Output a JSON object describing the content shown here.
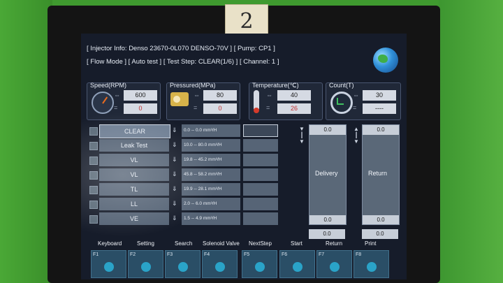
{
  "header": {
    "line1": "[ Injector Info: Denso   23670-0L070  DENSO-70V ]    [ Pump: CP1 ]",
    "line2": "[ Flow Mode ]    [ Auto test ]    [ Test Step: CLEAR(1/6) ]    [ Channel: 1 ]"
  },
  "sticker": {
    "text": "2"
  },
  "panels": {
    "speed": {
      "title": "Speed(RPM)",
      "set": "600",
      "actual": "0"
    },
    "pressure": {
      "title": "Pressured(MPa)",
      "set": "80",
      "actual": "0"
    },
    "temperature": {
      "title": "Temperature(℃)",
      "set": "40",
      "actual": "26"
    },
    "count": {
      "title": "Count(T)",
      "set": "30",
      "actual": "----"
    }
  },
  "steps": [
    {
      "name": "CLEAR",
      "range": "0.0 -- 0.0 mm³/H",
      "checked": false,
      "selected": true
    },
    {
      "name": "Leak Test",
      "range": "10.0 -- 80.0 mm³/H",
      "checked": false,
      "selected": false
    },
    {
      "name": "VL",
      "range": "19.8 -- 45.2 mm³/H",
      "checked": false,
      "selected": false
    },
    {
      "name": "VL",
      "range": "45.8 -- 58.2 mm³/H",
      "checked": false,
      "selected": false
    },
    {
      "name": "TL",
      "range": "19.9 -- 28.1 mm³/H",
      "checked": false,
      "selected": false
    },
    {
      "name": "LL",
      "range": "2.0 -- 6.0 mm³/H",
      "checked": false,
      "selected": false
    },
    {
      "name": "VE",
      "range": "1.5 -- 4.9 mm³/H",
      "checked": false,
      "selected": false
    }
  ],
  "delivery": {
    "label": "Delivery",
    "top": "0.0",
    "bottom": "0.0",
    "below": "0.0"
  },
  "return": {
    "label": "Return",
    "top": "0.0",
    "bottom": "0.0",
    "below": "0.0"
  },
  "function_keys": [
    {
      "label": "Keyboard",
      "key": "F1"
    },
    {
      "label": "Setting",
      "key": "F2"
    },
    {
      "label": "Search",
      "key": "F3"
    },
    {
      "label": "Solenoid Valve",
      "key": "F4"
    },
    {
      "label": "NextStep",
      "key": "F5"
    },
    {
      "label": "Start",
      "key": "F6"
    },
    {
      "label": "Return",
      "key": "F7"
    },
    {
      "label": "Print",
      "key": "F8"
    }
  ]
}
